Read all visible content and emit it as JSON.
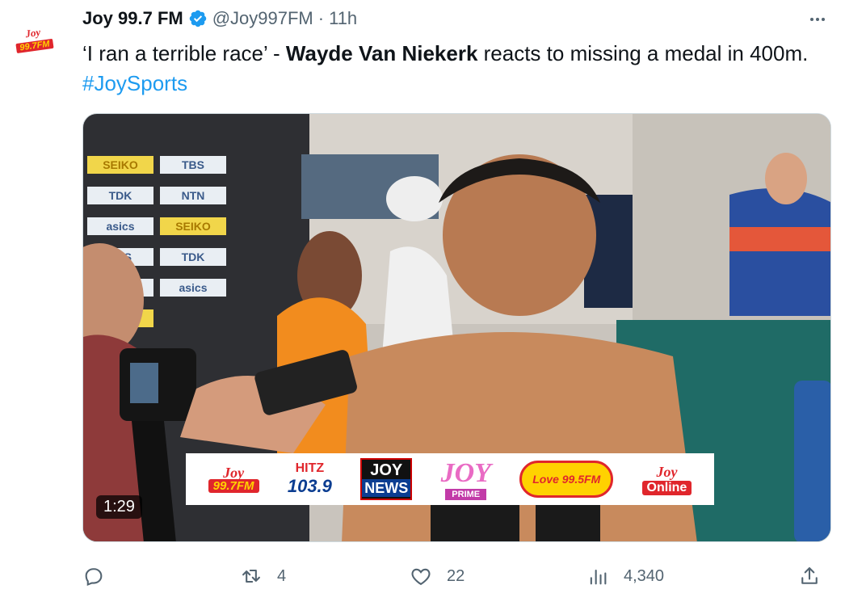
{
  "account": {
    "name": "Joy 99.7 FM",
    "handle": "@Joy997FM",
    "separator": "·",
    "time": "11h",
    "avatar_text_top": "Joy",
    "avatar_text_bottom": "99.7FM"
  },
  "tweet": {
    "part1": "‘I ran a terrible race’ - ",
    "bold": "Wayde Van Niekerk",
    "part2": " reacts to missing a medal in 400m. ",
    "hashtag": "#JoySports"
  },
  "media": {
    "duration": "1:29",
    "banner": {
      "joy_top": "Joy",
      "joy_freq": "99.7FM",
      "hitz_top": "HITZ",
      "hitz_freq": "103.9",
      "news_top": "JOY",
      "news_bottom": "NEWS",
      "prime_top": "JOY",
      "prime_bottom": "PRIME",
      "love_text": "Love 99.5FM",
      "online_top": "Joy",
      "online_bottom": "Online"
    },
    "sponsor_boards": [
      "SEIKO",
      "TBS",
      "TDK",
      "NTN",
      "asics",
      "SEIKO",
      "TBS",
      "TDK",
      "NTN",
      "asics",
      "SEIKO"
    ]
  },
  "actions": {
    "reply_count": "",
    "retweet_count": "4",
    "like_count": "22",
    "views_count": "4,340"
  },
  "colors": {
    "link": "#1d9bf0",
    "verified": "#1d9bf0",
    "muted": "#536471"
  }
}
